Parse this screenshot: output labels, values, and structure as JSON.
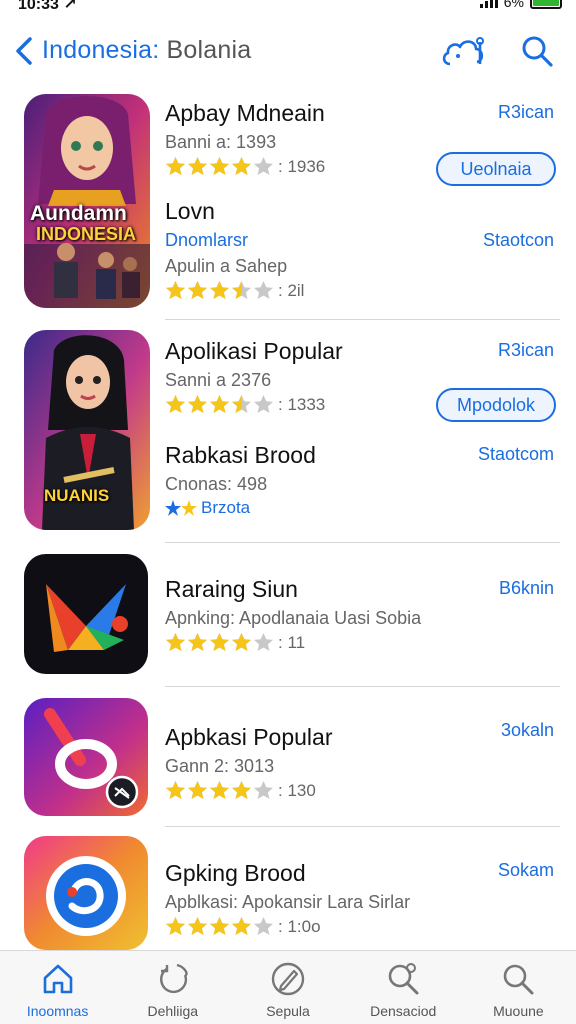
{
  "status_bar": {
    "time": "10:33 ↗",
    "battery": "6%"
  },
  "nav": {
    "back_label": "Indonesia:",
    "title_rest": " Bolania"
  },
  "apps": [
    {
      "icon_caption_top": "Aundamn",
      "icon_caption_bottom": "INDONESIA",
      "name": "Apbay Mdneain",
      "sub": "Banni a: 1393",
      "rating": 4,
      "rating_count": ": 1936",
      "action": "R3ican",
      "button": "Ueolnaia",
      "name2": "Lovn",
      "sub2": "Dnomlarsr",
      "sub3": "Apulin a Sahep",
      "rating2": 3.5,
      "rating2_count": ": 2il",
      "action2": "Staotcon"
    },
    {
      "icon_caption": "NUANIS",
      "name": "Apolikasi Popular",
      "sub": "Sanni a 2376",
      "rating": 3.5,
      "rating_count": ": 1333",
      "action": "R3ican",
      "button": "Mpodolok",
      "name2": "Rabkasi Brood",
      "sub2": "Cnonas: 498",
      "sub3": "Brzota",
      "action2": "Staotcom"
    },
    {
      "name": "Raraing Siun",
      "sub": "Apnking: Apodlanaia Uasi Sobia",
      "rating": 4,
      "rating_count": ": 11",
      "action": "B6knin"
    },
    {
      "name": "Apbkasi Popular",
      "sub": "Gann 2: 3013",
      "rating": 4,
      "rating_count": ": 130",
      "action": "3okaln"
    },
    {
      "name": "Gpking Brood",
      "sub": "Apblkasi: Apokansir Lara Sirlar",
      "rating": 4,
      "rating_count": ": 1:0o",
      "action": "Sokam"
    }
  ],
  "tabs": [
    {
      "label": "Inoomnas",
      "icon": "home-icon",
      "active": true
    },
    {
      "label": "Dehliiga",
      "icon": "refresh-icon",
      "active": false
    },
    {
      "label": "Sepula",
      "icon": "pen-icon",
      "active": false
    },
    {
      "label": "Densaciod",
      "icon": "search-star-icon",
      "active": false
    },
    {
      "label": "Muoune",
      "icon": "search-icon",
      "active": false
    }
  ],
  "colors": {
    "accent": "#1a6ee0",
    "star": "#f5c518",
    "star_empty": "#c8c8c8"
  }
}
